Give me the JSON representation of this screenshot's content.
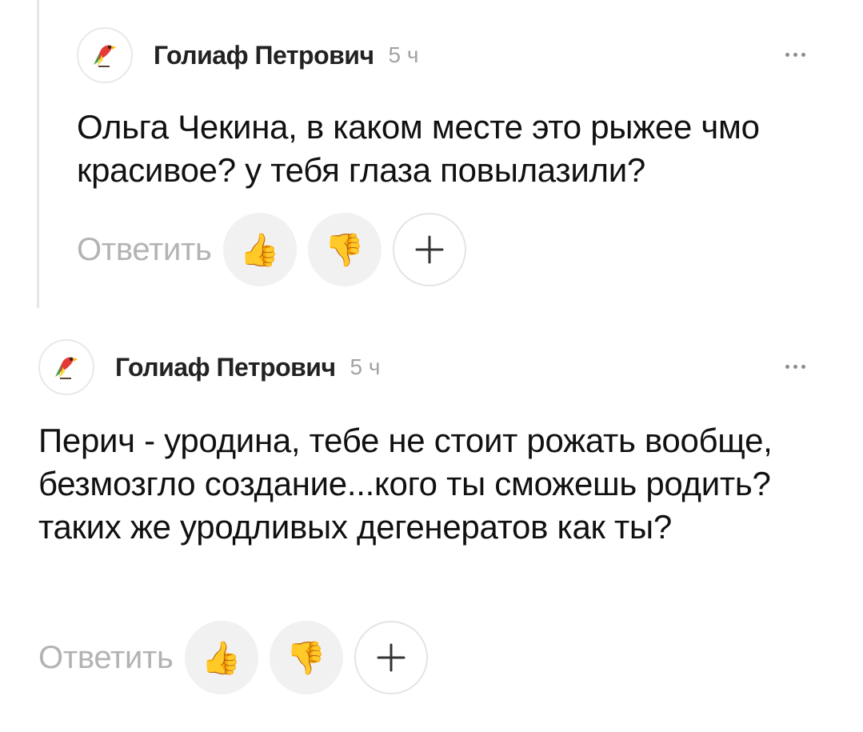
{
  "comments": [
    {
      "author": "Голиаф Петрович",
      "time": "5 ч",
      "text": "Ольга Чекина, в каком месте это рыжее чмо красивое? у тебя глаза повылазили?",
      "reply_label": "Ответить",
      "avatar_icon": "parrot-icon",
      "like_icon": "👍",
      "dislike_icon": "👎",
      "add_icon": "plus-icon"
    },
    {
      "author": "Голиаф Петрович",
      "time": "5 ч",
      "text": "Перич - уродина, тебе не стоит рожать вообще, безмозгло создание...кого ты сможешь родить? таких же уродливых дегенератов как ты?",
      "reply_label": "Ответить",
      "avatar_icon": "parrot-icon",
      "like_icon": "👍",
      "dislike_icon": "👎",
      "add_icon": "plus-icon"
    }
  ]
}
